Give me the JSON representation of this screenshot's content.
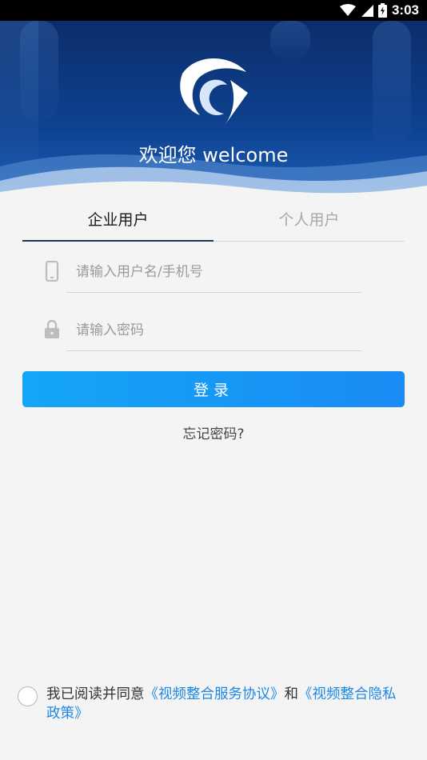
{
  "status_bar": {
    "time": "3:03",
    "icons": [
      "wifi-icon",
      "signal-icon",
      "battery-icon"
    ]
  },
  "header": {
    "welcome": "欢迎您 welcome",
    "logo_icon": "app-logo-icon"
  },
  "tabs": [
    {
      "label": "企业用户",
      "active": true
    },
    {
      "label": "个人用户",
      "active": false
    }
  ],
  "form": {
    "username": {
      "placeholder": "请输入用户名/手机号",
      "value": "",
      "icon": "phone-icon"
    },
    "password": {
      "placeholder": "请输入密码",
      "value": "",
      "icon": "lock-icon"
    },
    "login_label": "登录",
    "forgot_label": "忘记密码?"
  },
  "agreement": {
    "checked": false,
    "prefix": "我已阅读并同意",
    "service_link": "《视频整合服务协议》",
    "conjunction": "和",
    "privacy_link": "《视频整合隐私政策》"
  },
  "colors": {
    "banner": "#0f4291",
    "accent": "#1a8bf5",
    "link": "#1e88e5",
    "tab_underline": "#20345e"
  }
}
